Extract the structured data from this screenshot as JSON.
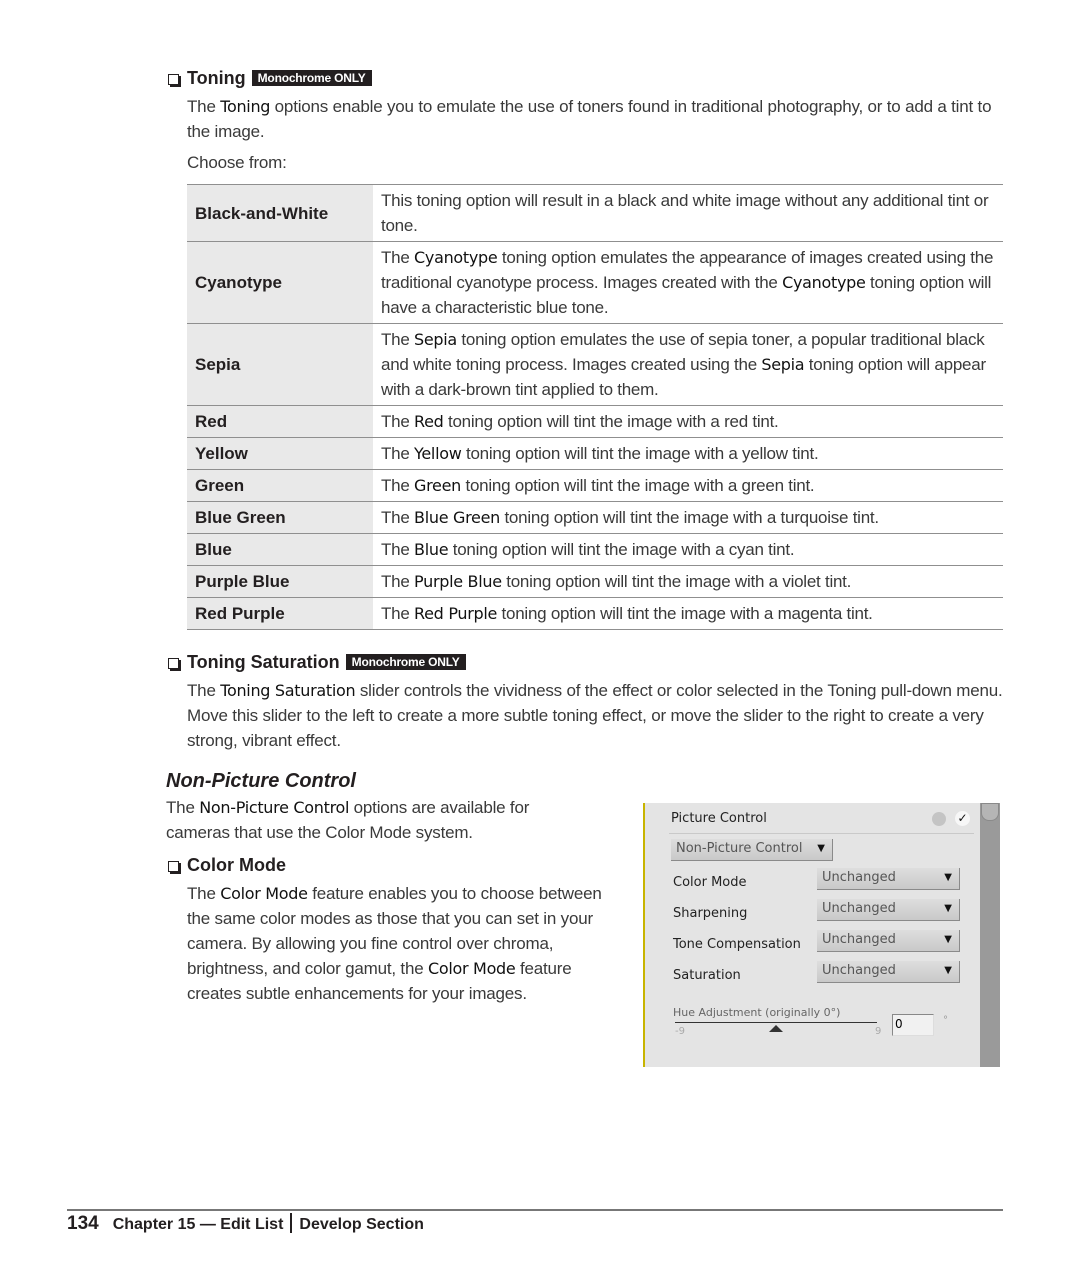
{
  "toning": {
    "title": "Toning",
    "badge": "Monochrome ONLY",
    "intro": {
      "pre": "The ",
      "kw": "Toning",
      "post": " options enable you to emulate the use of toners found in traditional photography, or to add a tint to the image."
    },
    "choose_from": "Choose from:",
    "options": [
      {
        "name": "Black-and-White",
        "desc": [
          {
            "t": "This toning option will result in a black and white image without any additional tint or tone."
          }
        ]
      },
      {
        "name": "Cyanotype",
        "desc": [
          {
            "t": "The "
          },
          {
            "k": "Cyanotype"
          },
          {
            "t": " toning option emulates the appearance of images created using the traditional cyanotype process. Images created with the "
          },
          {
            "k": "Cyanotype"
          },
          {
            "t": " toning option will have a characteristic blue tone."
          }
        ]
      },
      {
        "name": "Sepia",
        "desc": [
          {
            "t": "The "
          },
          {
            "k": "Sepia"
          },
          {
            "t": " toning option emulates the use of sepia toner, a popular traditional black and white toning process. Images created using the "
          },
          {
            "k": "Sepia"
          },
          {
            "t": " toning option will appear with a dark-brown tint applied to them."
          }
        ]
      },
      {
        "name": "Red",
        "desc": [
          {
            "t": "The "
          },
          {
            "k": "Red"
          },
          {
            "t": " toning option will tint the image with a red tint."
          }
        ]
      },
      {
        "name": "Yellow",
        "desc": [
          {
            "t": "The "
          },
          {
            "k": "Yellow"
          },
          {
            "t": " toning option will tint the image with a yellow tint."
          }
        ]
      },
      {
        "name": "Green",
        "desc": [
          {
            "t": "The "
          },
          {
            "k": "Green"
          },
          {
            "t": " toning option will tint the image with a green tint."
          }
        ]
      },
      {
        "name": "Blue Green",
        "desc": [
          {
            "t": "The "
          },
          {
            "k": "Blue Green"
          },
          {
            "t": " toning option will tint the image with a turquoise tint."
          }
        ]
      },
      {
        "name": "Blue",
        "desc": [
          {
            "t": "The "
          },
          {
            "k": "Blue"
          },
          {
            "t": " toning option will tint the image with a cyan tint."
          }
        ]
      },
      {
        "name": "Purple Blue",
        "desc": [
          {
            "t": "The "
          },
          {
            "k": "Purple Blue"
          },
          {
            "t": " toning option will tint the image with a violet tint."
          }
        ]
      },
      {
        "name": "Red Purple",
        "desc": [
          {
            "t": "The "
          },
          {
            "k": "Red Purple"
          },
          {
            "t": " toning option will tint the image with a magenta tint."
          }
        ]
      }
    ]
  },
  "toning_saturation": {
    "title": "Toning Saturation",
    "badge": "Monochrome ONLY",
    "body": {
      "pre": "The ",
      "kw": "Toning Saturation",
      "post": " slider controls the vividness of the effect or color selected in the Toning pull-down menu. Move this slider to the left to create a more subtle toning effect, or move the slider to the right to create a very strong, vibrant effect."
    }
  },
  "non_picture_control": {
    "title": "Non-Picture Control",
    "body": {
      "pre": "The ",
      "kw": "Non-Picture Control",
      "post": " options are available for cameras that use the Color Mode system."
    }
  },
  "color_mode": {
    "title": "Color Mode",
    "body": {
      "pre": "The ",
      "kw": "Color Mode",
      "mid": " feature enables you to choose between the same color modes as those that you can set in your camera. By allowing you fine control over chroma, brightness, and color gamut, the ",
      "kw2": "Color Mode",
      "post": " feature creates subtle enhancements for your images."
    }
  },
  "panel": {
    "title": "Picture Control",
    "mode_select": "Non-Picture Control",
    "rows": [
      {
        "label": "Color Mode",
        "value": "Unchanged"
      },
      {
        "label": "Sharpening",
        "value": "Unchanged"
      },
      {
        "label": "Tone Compensation",
        "value": "Unchanged"
      },
      {
        "label": "Saturation",
        "value": "Unchanged"
      }
    ],
    "hue": {
      "label": "Hue Adjustment (originally 0°)",
      "min": "-9",
      "max": "9",
      "value": "0",
      "unit": "°",
      "slider_fraction": 0.5
    }
  },
  "footer": {
    "page_number": "134",
    "chapter": "Chapter 15 — Edit List",
    "section": "Develop Section"
  }
}
